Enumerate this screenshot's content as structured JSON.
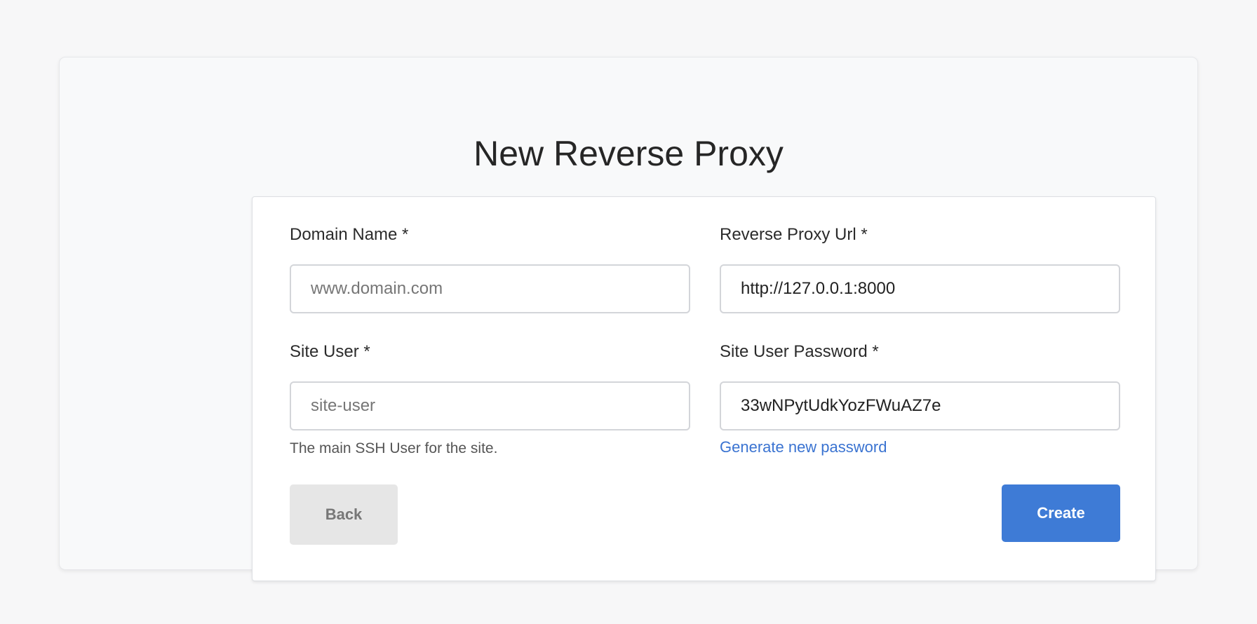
{
  "page": {
    "title": "New Reverse Proxy"
  },
  "form": {
    "domain_name": {
      "label": "Domain Name *",
      "value": "",
      "placeholder": "www.domain.com"
    },
    "reverse_proxy_url": {
      "label": "Reverse Proxy Url *",
      "value": "http://127.0.0.1:8000",
      "placeholder": ""
    },
    "site_user": {
      "label": "Site User *",
      "value": "",
      "placeholder": "site-user",
      "help": "The main SSH User for the site."
    },
    "site_user_password": {
      "label": "Site User Password *",
      "value": "33wNPytUdkYozFWuAZ7e",
      "placeholder": "",
      "generate_link": "Generate new password"
    }
  },
  "actions": {
    "back_label": "Back",
    "create_label": "Create"
  },
  "colors": {
    "primary": "#3e7bd6",
    "link": "#3a73d1",
    "secondary_button": "#e6e6e6"
  }
}
